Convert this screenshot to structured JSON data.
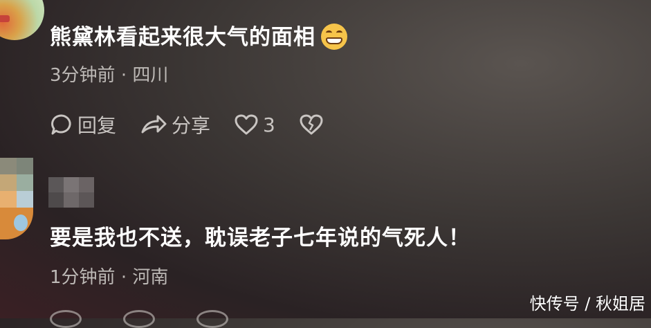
{
  "comments": [
    {
      "text": "熊黛林看起来很大气的面相",
      "emoji": "grinning-face-emoji",
      "time": "3分钟前",
      "separator": "·",
      "location": "四川",
      "actions": {
        "reply_label": "回复",
        "share_label": "分享",
        "like_count": "3"
      }
    },
    {
      "text": "要是我也不送，耽误老子七年说的气死人！",
      "time": "1分钟前",
      "separator": "·",
      "location": "河南"
    }
  ],
  "watermark": "快传号 / 秋姐居",
  "colors": {
    "text_primary": "#ffffff",
    "text_meta": "#bdb9b6",
    "emoji_yellow": "#f6c44a"
  }
}
